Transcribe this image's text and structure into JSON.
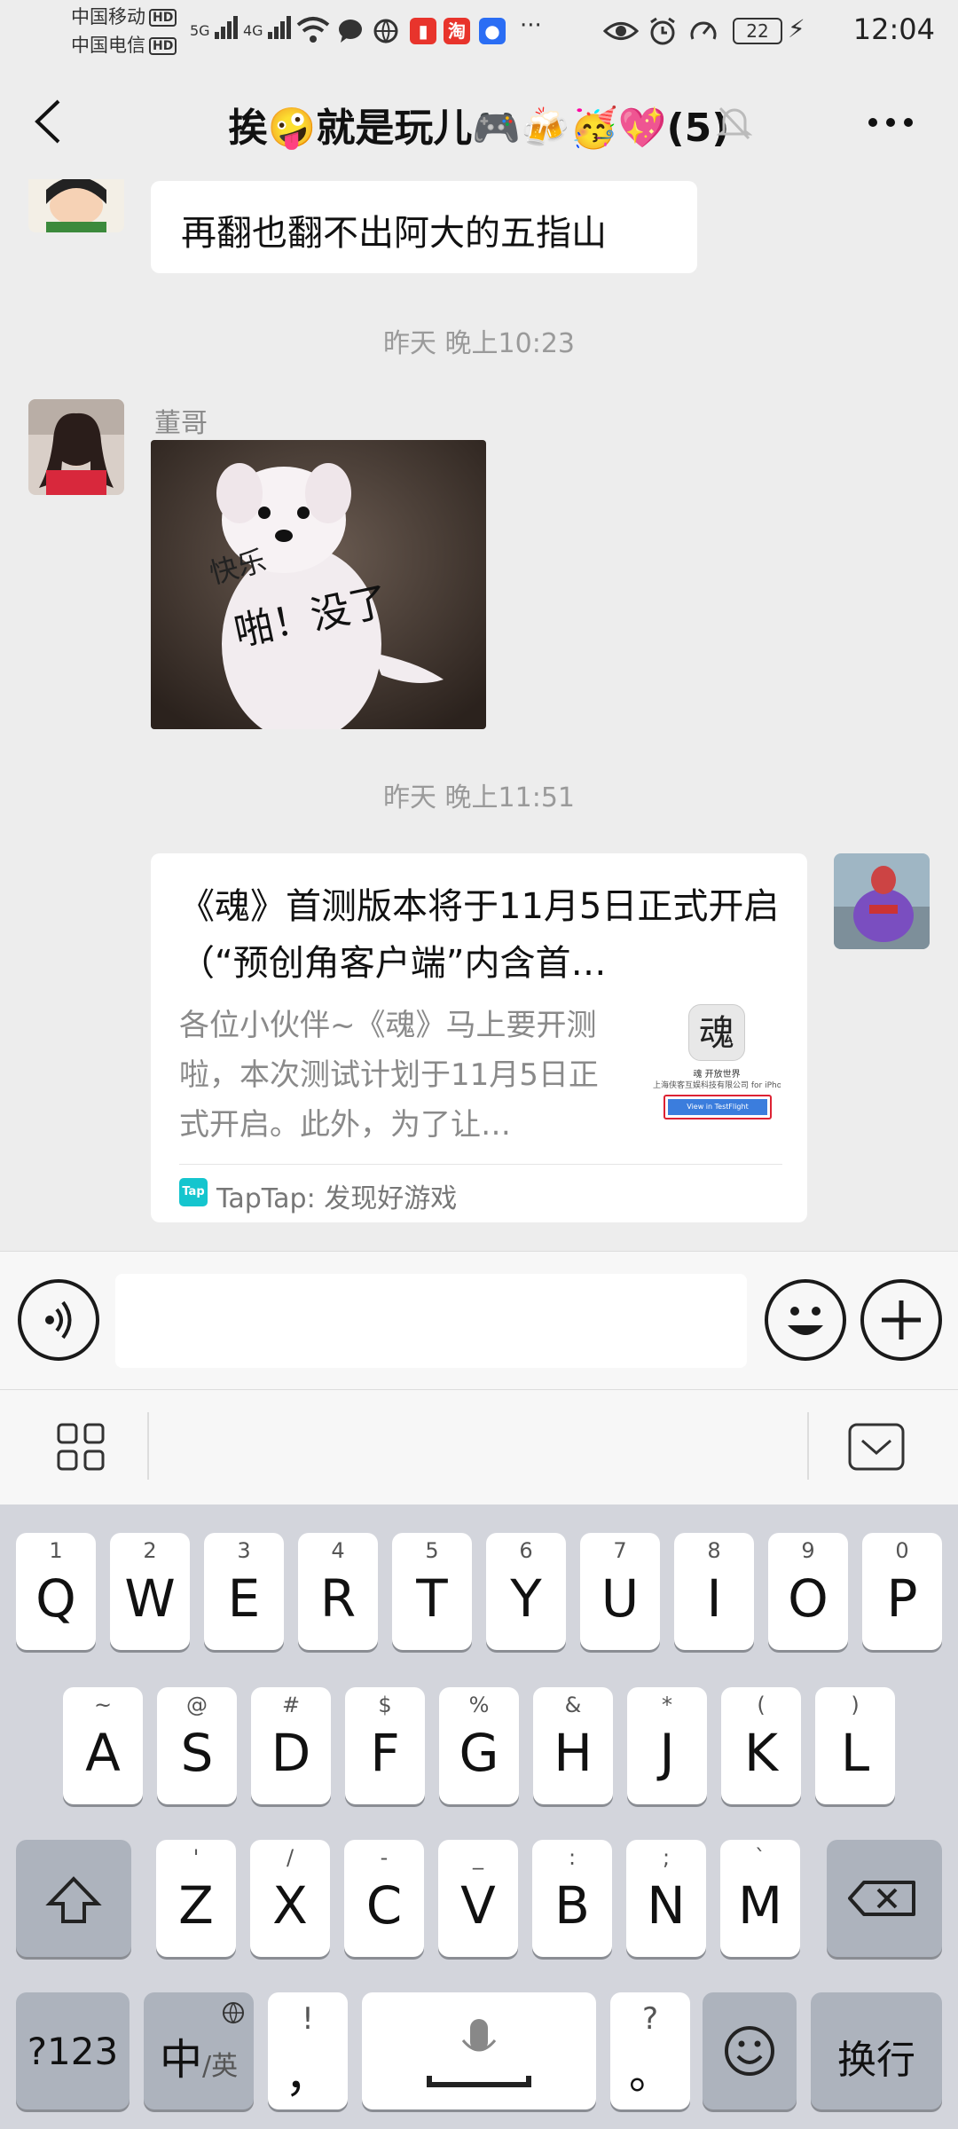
{
  "status_bar": {
    "carrier1": "中国移动",
    "carrier2": "中国电信",
    "hd": "HD",
    "net1": "5G",
    "net2": "4G",
    "battery": "22",
    "time": "12:04",
    "more": "···",
    "app_taobao": "淘"
  },
  "header": {
    "title": "挨🤪就是玩儿🎮🍻🥳💖(5)"
  },
  "messages": {
    "m1_text": "再翻也翻不出阿大的五指山",
    "ts1": "昨天 晚上10:23",
    "m2_sender": "董哥",
    "sticker_text1": "快乐",
    "sticker_text2": "啪！没了",
    "ts2": "昨天 晚上11:51",
    "card": {
      "title": "《魂》首测版本将于11月5日正式开启（“预创角客户端”内含首…",
      "desc": "各位小伙伴~《魂》马上要开测啦，本次测试计划于11月5日正式开启。此外，为了让…",
      "thumb_glyph": "魂",
      "thumb_line1": "魂 开放世界",
      "thumb_line2": "上海侠客互娱科技有限公司 for iPhone",
      "thumb_button": "View in TestFlight",
      "source_logo": "Tap",
      "source": "TapTap: 发现好游戏"
    }
  },
  "keyboard": {
    "row1": [
      {
        "sup": "1",
        "main": "Q"
      },
      {
        "sup": "2",
        "main": "W"
      },
      {
        "sup": "3",
        "main": "E"
      },
      {
        "sup": "4",
        "main": "R"
      },
      {
        "sup": "5",
        "main": "T"
      },
      {
        "sup": "6",
        "main": "Y"
      },
      {
        "sup": "7",
        "main": "U"
      },
      {
        "sup": "8",
        "main": "I"
      },
      {
        "sup": "9",
        "main": "O"
      },
      {
        "sup": "0",
        "main": "P"
      }
    ],
    "row2": [
      {
        "sup": "~",
        "main": "A"
      },
      {
        "sup": "@",
        "main": "S"
      },
      {
        "sup": "#",
        "main": "D"
      },
      {
        "sup": "$",
        "main": "F"
      },
      {
        "sup": "%",
        "main": "G"
      },
      {
        "sup": "&",
        "main": "H"
      },
      {
        "sup": "*",
        "main": "J"
      },
      {
        "sup": "(",
        "main": "K"
      },
      {
        "sup": ")",
        "main": "L"
      }
    ],
    "row3": [
      {
        "sup": "'",
        "main": "Z"
      },
      {
        "sup": "/",
        "main": "X"
      },
      {
        "sup": "-",
        "main": "C"
      },
      {
        "sup": "_",
        "main": "V"
      },
      {
        "sup": ":",
        "main": "B"
      },
      {
        "sup": ";",
        "main": "N"
      },
      {
        "sup": "`",
        "main": "M"
      }
    ],
    "numbers_label": "?123",
    "lang_main": "中",
    "lang_sub": "/英",
    "comma_sup": "!",
    "comma_main": "，",
    "period_sup": "?",
    "period_main": "。",
    "enter_label": "换行"
  },
  "icons": [
    "back-arrow-icon",
    "mute-bell-icon",
    "more-dots-icon",
    "voice-icon",
    "emoji-icon",
    "plus-icon",
    "grid-icon",
    "keyboard-hide-icon",
    "shift-icon",
    "backspace-icon",
    "mic-icon",
    "globe-icon"
  ],
  "colors": {
    "chat_bg": "#ededed",
    "bubble": "#ffffff",
    "keyboard_bg": "#d3d5dc",
    "taptap": "#15c5ce"
  }
}
